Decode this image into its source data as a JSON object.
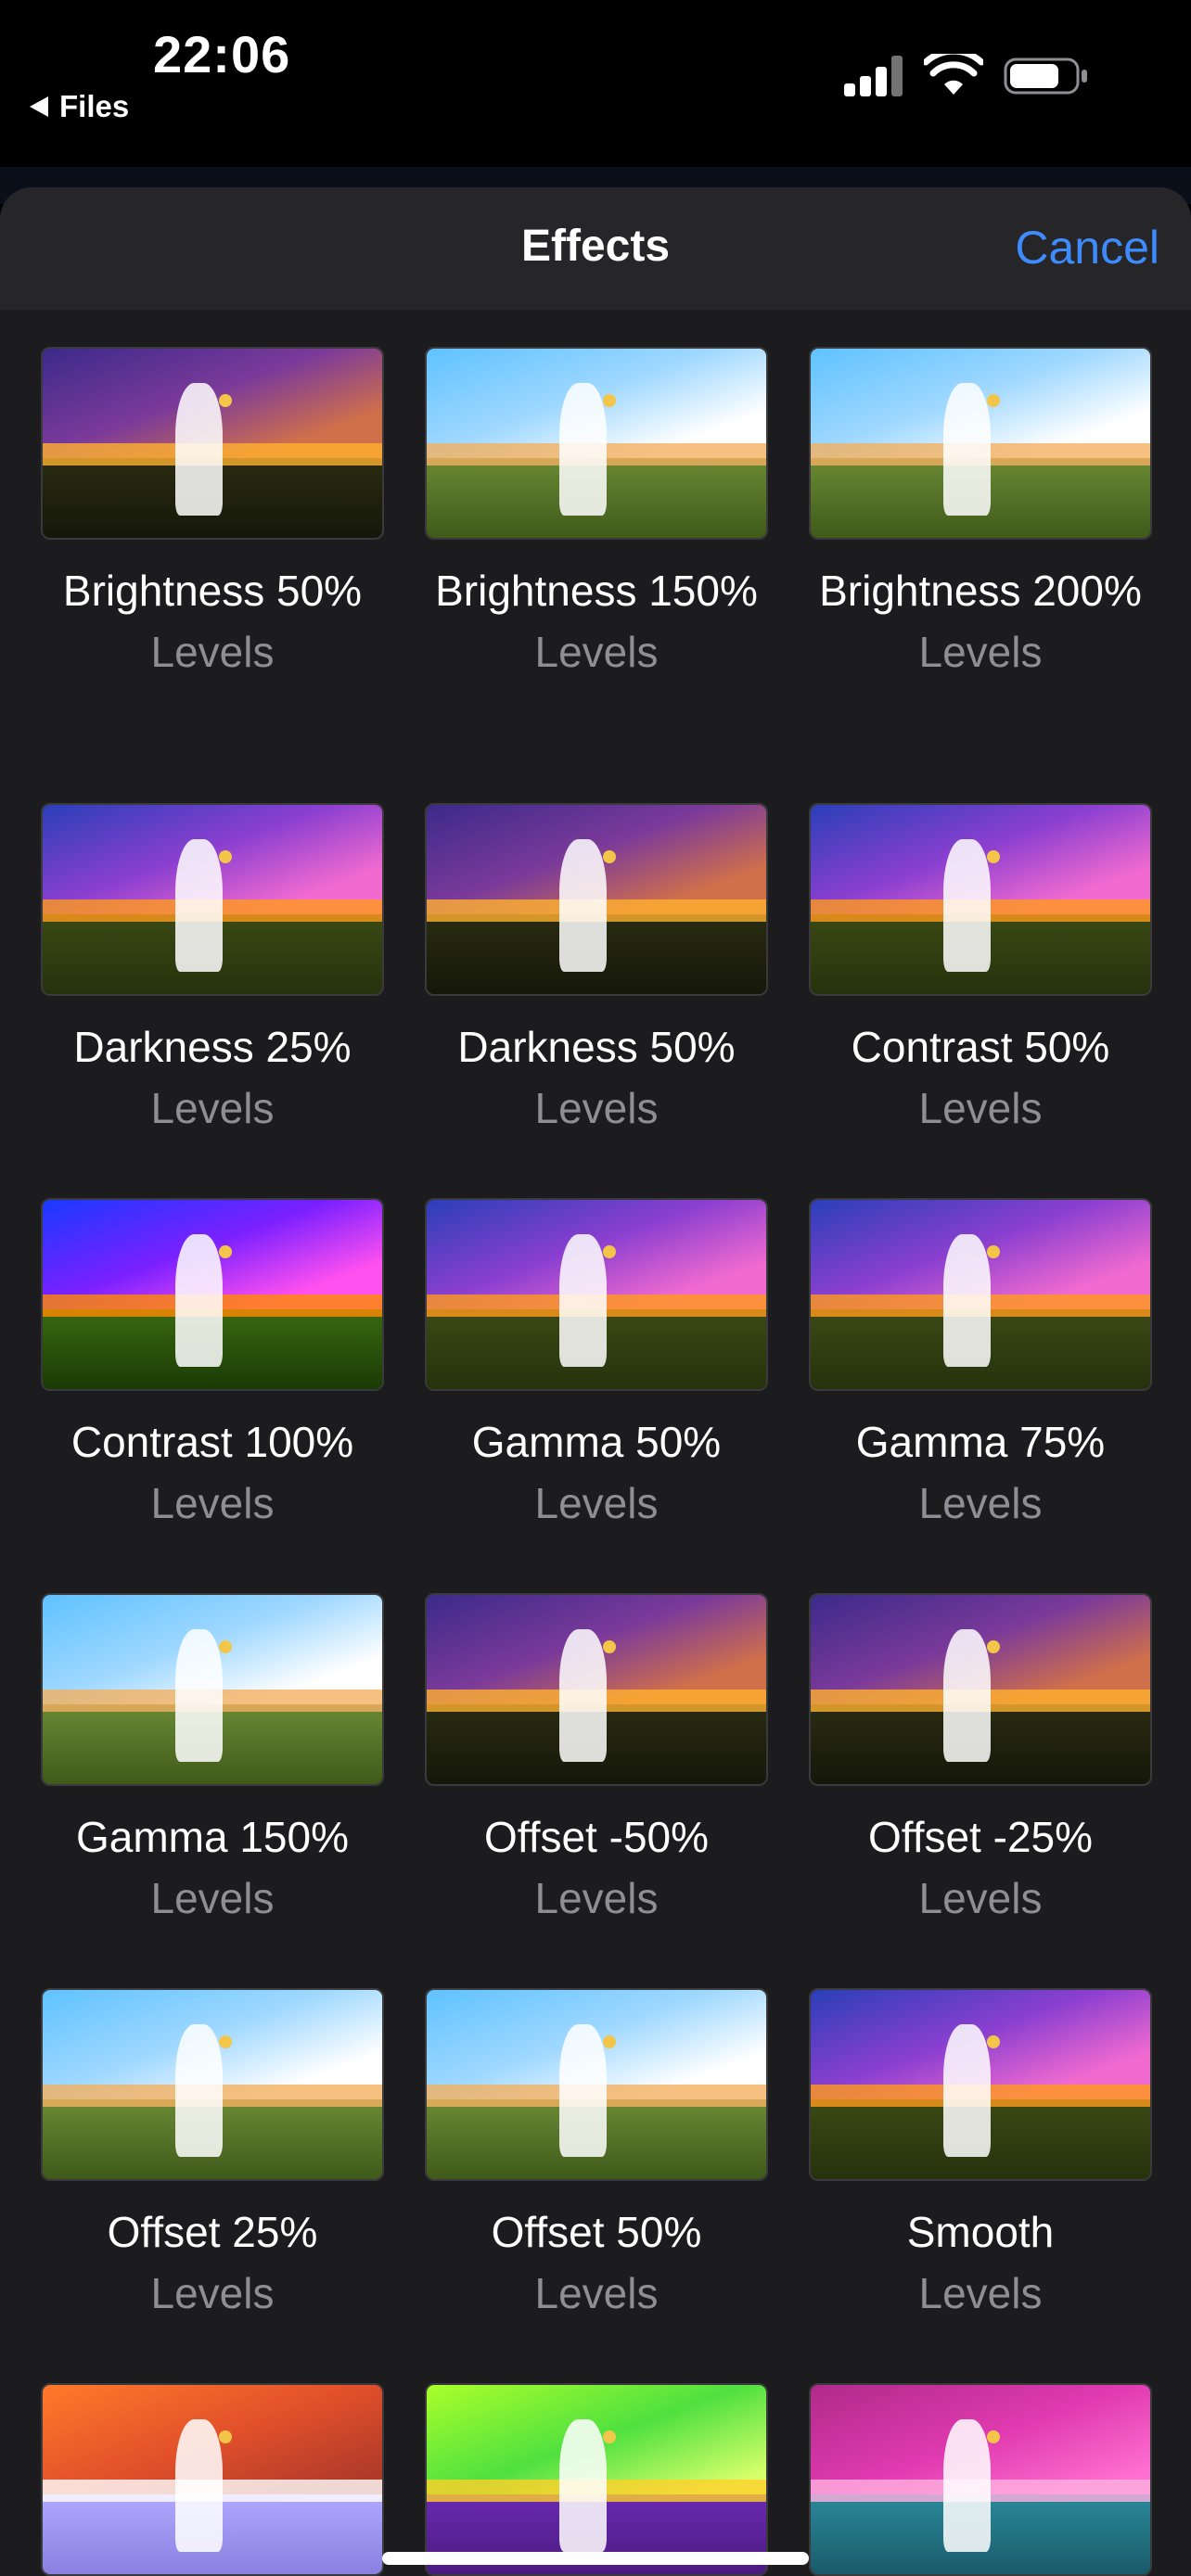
{
  "status_bar": {
    "time": "22:06",
    "back_app": "Files"
  },
  "header": {
    "title": "Effects",
    "cancel_label": "Cancel"
  },
  "effects": [
    {
      "label": "Brightness 50%",
      "category": "Levels",
      "variant": "dark"
    },
    {
      "label": "Brightness 150%",
      "category": "Levels",
      "variant": "bright"
    },
    {
      "label": "Brightness 200%",
      "category": "Levels",
      "variant": "bright"
    },
    {
      "label": "Darkness 25%",
      "category": "Levels",
      "variant": "normal"
    },
    {
      "label": "Darkness 50%",
      "category": "Levels",
      "variant": "dark"
    },
    {
      "label": "Contrast 50%",
      "category": "Levels",
      "variant": "normal"
    },
    {
      "label": "Contrast 100%",
      "category": "Levels",
      "variant": "contrast"
    },
    {
      "label": "Gamma 50%",
      "category": "Levels",
      "variant": "normal"
    },
    {
      "label": "Gamma 75%",
      "category": "Levels",
      "variant": "normal"
    },
    {
      "label": "Gamma 150%",
      "category": "Levels",
      "variant": "bright"
    },
    {
      "label": "Offset -50%",
      "category": "Levels",
      "variant": "dark"
    },
    {
      "label": "Offset -25%",
      "category": "Levels",
      "variant": "dark"
    },
    {
      "label": "Offset 25%",
      "category": "Levels",
      "variant": "bright"
    },
    {
      "label": "Offset 50%",
      "category": "Levels",
      "variant": "bright"
    },
    {
      "label": "Smooth",
      "category": "Levels",
      "variant": "normal"
    },
    {
      "label": "",
      "category": "",
      "variant": "orange"
    },
    {
      "label": "",
      "category": "",
      "variant": "green"
    },
    {
      "label": "",
      "category": "",
      "variant": "magenta"
    }
  ]
}
